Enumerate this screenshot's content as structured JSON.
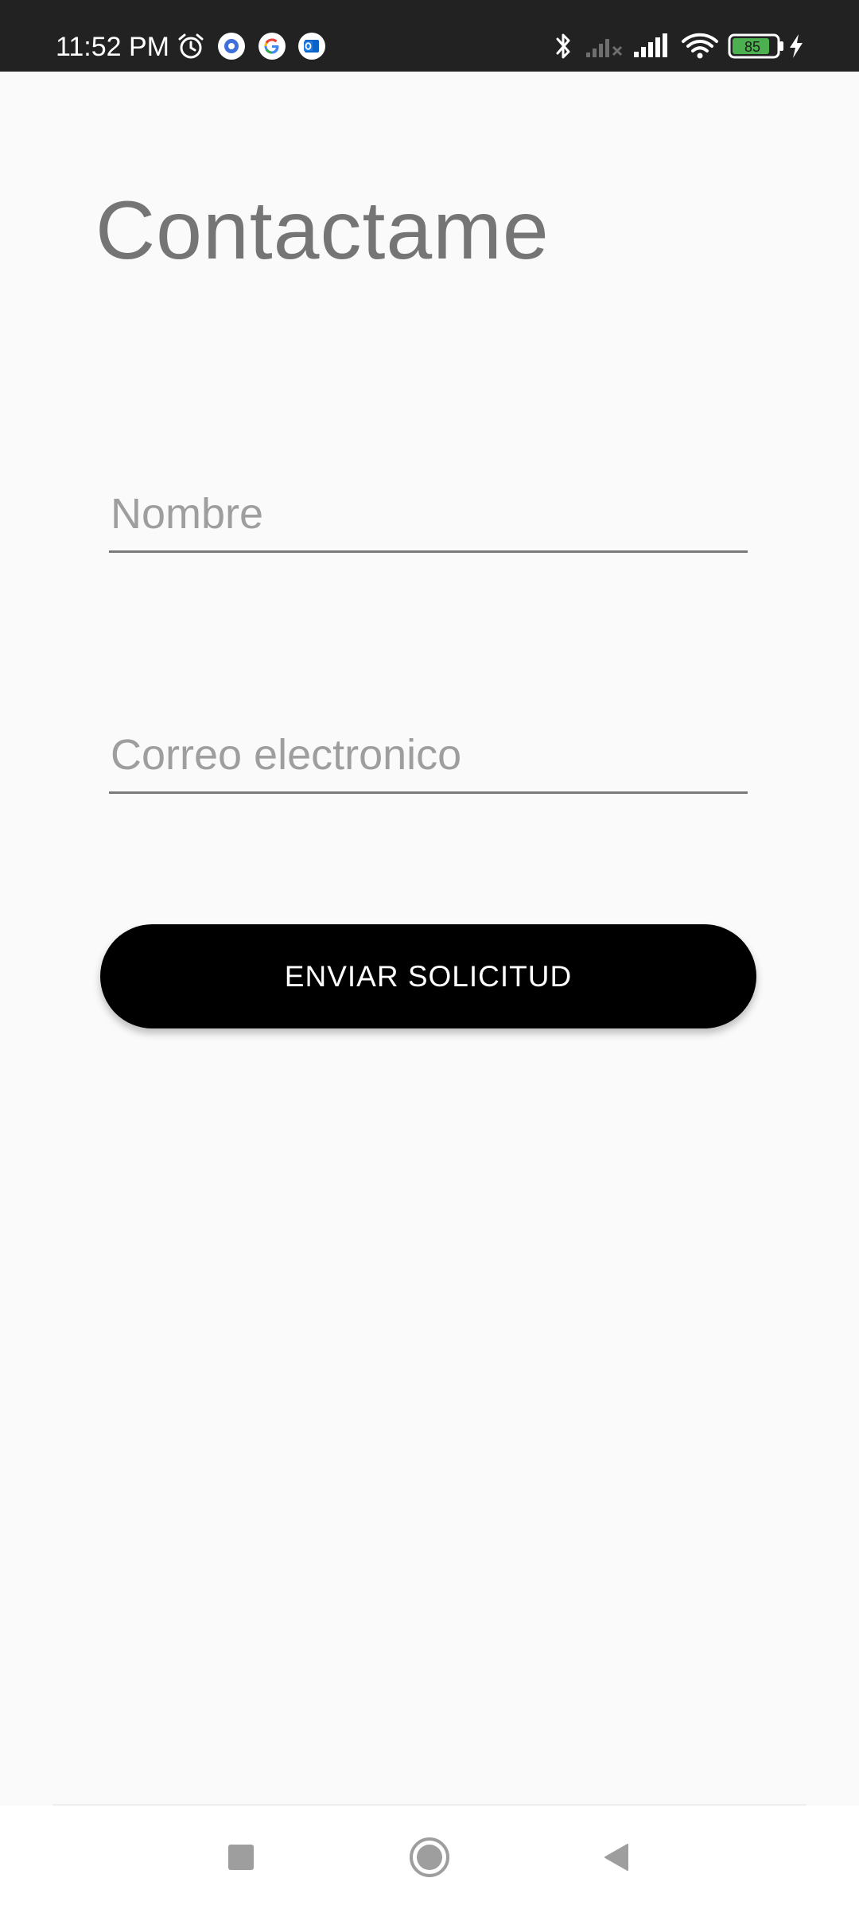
{
  "status_bar": {
    "time": "11:52 PM",
    "left_icons": [
      "alarm-icon",
      "settings-notification-icon",
      "google-icon",
      "outlook-icon"
    ],
    "right_icons": [
      "bluetooth-icon",
      "signal-no-service-icon",
      "signal-icon",
      "wifi-icon",
      "battery-icon",
      "charging-icon"
    ],
    "battery_level": "85",
    "battery_color": "#4caf50"
  },
  "page": {
    "title": "Contactame"
  },
  "form": {
    "name_placeholder": "Nombre",
    "email_placeholder": "Correo electronico",
    "submit_label": "ENVIAR SOLICITUD"
  },
  "nav_bar": {
    "buttons": [
      "recents-icon",
      "home-icon",
      "back-icon"
    ]
  },
  "colors": {
    "background": "#fafafa",
    "status_bar": "#222222",
    "title": "#757575",
    "button": "#000000"
  }
}
